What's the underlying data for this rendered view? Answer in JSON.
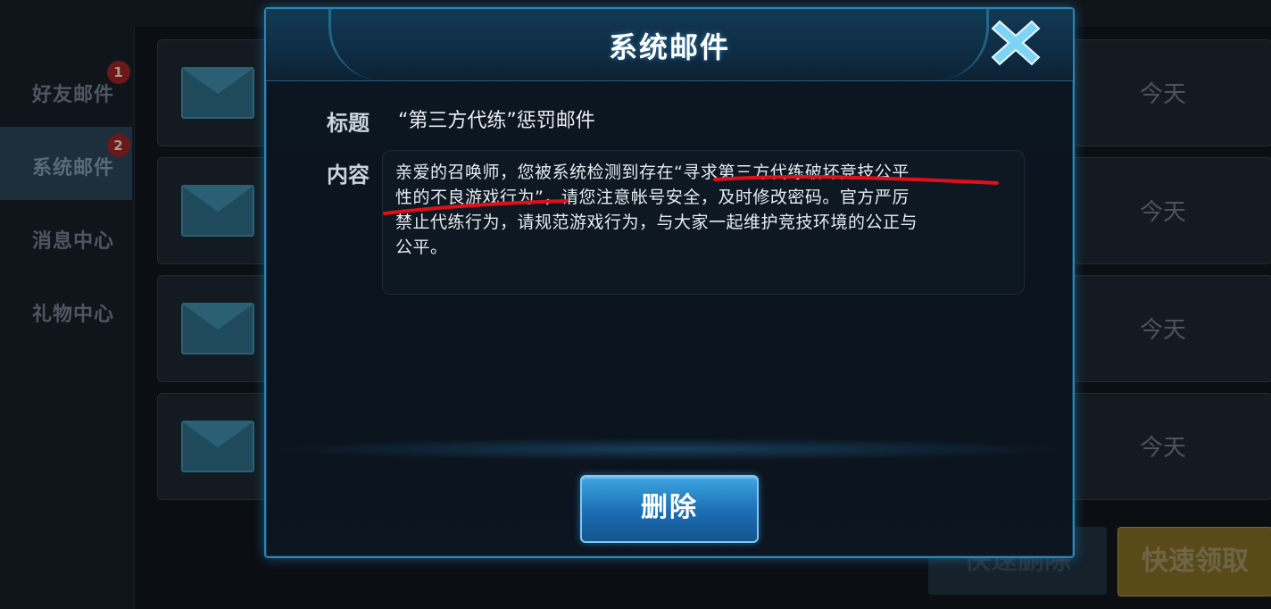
{
  "sidebar": {
    "items": [
      {
        "label": "好友邮件",
        "badge": "1"
      },
      {
        "label": "系统邮件",
        "badge": "2"
      },
      {
        "label": "消息中心"
      },
      {
        "label": "礼物中心"
      }
    ]
  },
  "mail_list": {
    "rows": [
      {
        "date": "今天",
        "icon": "envelope-closed-icon"
      },
      {
        "date": "今天",
        "icon": "envelope-closed-icon"
      },
      {
        "date": "今天",
        "icon": "envelope-open-icon"
      },
      {
        "date": "今天",
        "icon": "envelope-open-icon"
      }
    ]
  },
  "bottom_buttons": {
    "quick_delete": "快速删除",
    "quick_collect": "快速领取"
  },
  "modal": {
    "title": "系统邮件",
    "subject_label": "标题",
    "subject_value": "“第三方代练”惩罚邮件",
    "content_label": "内容",
    "content_lines": [
      "亲爱的召唤师，您被系统检测到存在“寻求第三方代练破坏竞技公平",
      "性的不良游戏行为”，请您注意帐号安全，及时修改密码。官方严厉",
      "禁止代练行为，请规范游戏行为，与大家一起维护竞技环境的公正与",
      "公平。"
    ],
    "delete_label": "删除"
  },
  "colors": {
    "accent": "#2a87b6",
    "button_blue": "#1a6db3",
    "annotation_red": "#e0101a",
    "gold": "#7d6a26"
  }
}
